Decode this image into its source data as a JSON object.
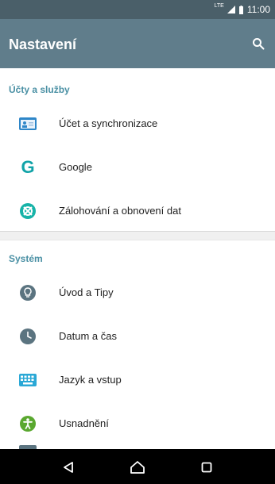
{
  "status_bar": {
    "time": "11:00",
    "network": "LTE"
  },
  "app_bar": {
    "title": "Nastavení",
    "search_icon": "search-icon"
  },
  "sections": [
    {
      "header": "Účty a služby",
      "items": [
        {
          "label": "Účet a synchronizace",
          "icon": "account-card-icon"
        },
        {
          "label": "Google",
          "icon": "google-icon"
        },
        {
          "label": "Zálohování a obnovení dat",
          "icon": "backup-icon"
        }
      ]
    },
    {
      "header": "Systém",
      "items": [
        {
          "label": "Úvod a Tipy",
          "icon": "tips-icon"
        },
        {
          "label": "Datum a čas",
          "icon": "clock-icon"
        },
        {
          "label": "Jazyk a vstup",
          "icon": "keyboard-icon"
        },
        {
          "label": "Usnadnění",
          "icon": "accessibility-icon"
        }
      ]
    }
  ],
  "nav_bar": {
    "back": "back-icon",
    "home": "home-icon",
    "recents": "recents-icon"
  },
  "colors": {
    "app_bar": "#607d8b",
    "status_bar": "#4a5f69",
    "accent": "#4a90a4"
  }
}
